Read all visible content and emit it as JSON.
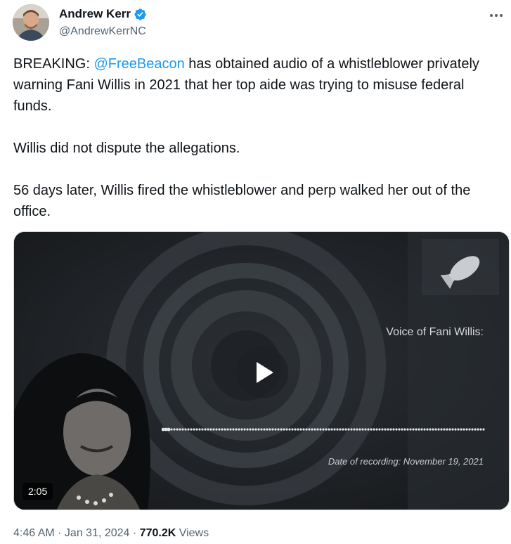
{
  "author": {
    "display_name": "Andrew Kerr",
    "handle": "@AndrewKerrNC",
    "verified_color": "#1d9bf0"
  },
  "tweet": {
    "para1_prefix": "BREAKING: ",
    "para1_mention": "@FreeBeacon",
    "para1_suffix": " has obtained audio of a whistleblower privately warning Fani Willis in 2021 that her top aide was trying to misuse federal funds.",
    "para2": "Willis did not dispute the allegations.",
    "para3": "56 days later, Willis fired the whistleblower and perp walked her out of the office."
  },
  "media": {
    "voice_label": "Voice of Fani Willis:",
    "recording_date": "Date of recording: November 19, 2021",
    "duration": "2:05",
    "icons": [
      "play-icon",
      "bomb-logo-icon"
    ]
  },
  "meta": {
    "time": "4:46 AM",
    "separator": " · ",
    "date": "Jan 31, 2024",
    "views_count": "770.2K",
    "views_label": " Views"
  },
  "colors": {
    "link": "#1d9bf0",
    "secondary_text": "#536471",
    "primary_text": "#0f1419"
  }
}
